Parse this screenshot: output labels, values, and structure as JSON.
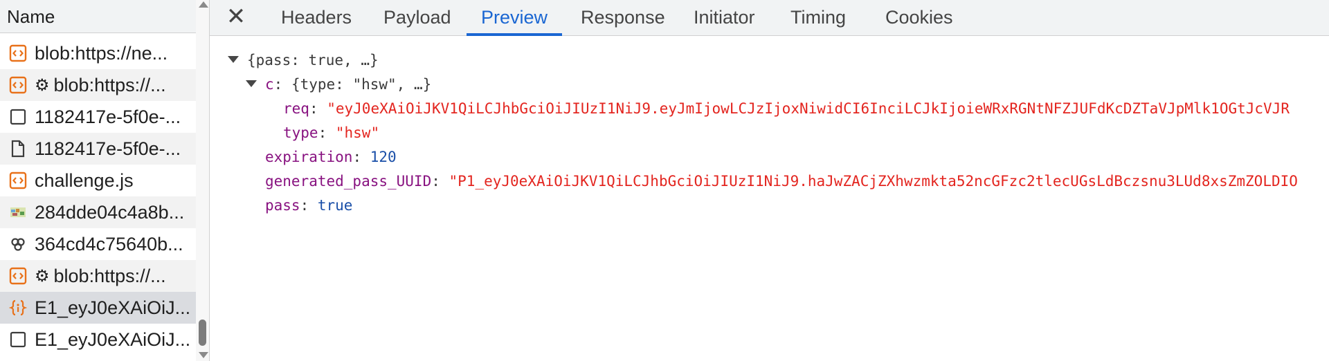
{
  "list_header": {
    "name_label": "Name"
  },
  "requests": [
    {
      "icon": "script-icon",
      "gear": false,
      "label": "blob:https://ne...",
      "style": "normal"
    },
    {
      "icon": "script-icon",
      "gear": true,
      "label": "blob:https://...",
      "style": "striped"
    },
    {
      "icon": "document-icon",
      "gear": false,
      "label": "1182417e-5f0e-...",
      "style": "normal"
    },
    {
      "icon": "file-icon",
      "gear": false,
      "label": "1182417e-5f0e-...",
      "style": "striped"
    },
    {
      "icon": "script-icon",
      "gear": false,
      "label": "challenge.js",
      "style": "normal"
    },
    {
      "icon": "image-icon",
      "gear": false,
      "label": "284dde04c4a8b...",
      "style": "striped"
    },
    {
      "icon": "wasm-icon",
      "gear": false,
      "label": "364cd4c75640b...",
      "style": "normal"
    },
    {
      "icon": "script-icon",
      "gear": true,
      "label": "blob:https://...",
      "style": "striped"
    },
    {
      "icon": "json-icon",
      "gear": false,
      "label": "E1_eyJ0eXAiOiJ...",
      "style": "selected"
    },
    {
      "icon": "document-icon",
      "gear": false,
      "label": "E1_eyJ0eXAiOiJ...",
      "style": "normal"
    }
  ],
  "tabs": {
    "close_glyph": "✕",
    "items": [
      "Headers",
      "Payload",
      "Preview",
      "Response",
      "Initiator",
      "Timing",
      "Cookies"
    ],
    "active": "Preview"
  },
  "preview": {
    "root_summary": "{pass: true, …}",
    "c_key": "c",
    "c_summary": "{type: \"hsw\", …}",
    "req_key": "req",
    "req_value": "\"eyJ0eXAiOiJKV1QiLCJhbGciOiJIUzI1NiJ9.eyJmIjowLCJzIjoxNiwidCI6InciLCJkIjoieWRxRGNtNFZJUFdKcDZTaVJpMlk1OGtJcVJR",
    "type_key": "type",
    "type_value": "\"hsw\"",
    "expiration_key": "expiration",
    "expiration_value": "120",
    "uuid_key": "generated_pass_UUID",
    "uuid_value": "\"P1_eyJ0eXAiOiJKV1QiLCJhbGciOiJIUzI1NiJ9.haJwZACjZXhwzmkta52ncGFzc2tlecUGsLdBczsnu3LUd8xsZmZOLDIO",
    "pass_key": "pass",
    "pass_value": "true"
  },
  "colors": {
    "accent": "#1a66d2",
    "string": "#e3251f",
    "number": "#1a4fa8",
    "key": "#881280",
    "script_icon": "#e8711a"
  }
}
